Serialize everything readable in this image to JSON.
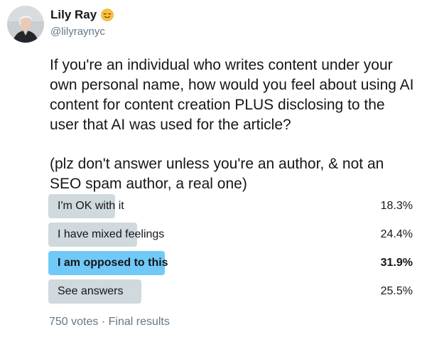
{
  "author": {
    "display_name": "Lily Ray",
    "handle": "@lilyraynyc",
    "emoji": "relieved-face-emoji"
  },
  "tweet": {
    "paragraph_1": "If you're an individual who writes content under your own personal name, how would you feel about using AI content for content creation PLUS disclosing to the user that AI was used for the article?",
    "paragraph_2": "(plz don't answer unless you're an author, & not an SEO spam author, a real one)"
  },
  "poll": {
    "options": [
      {
        "label": "I'm OK with it",
        "percent": "18.3%",
        "share": 0.183,
        "winner": false
      },
      {
        "label": "I have mixed feelings",
        "percent": "24.4%",
        "share": 0.244,
        "winner": false
      },
      {
        "label": "I am opposed to this",
        "percent": "31.9%",
        "share": 0.319,
        "winner": true
      },
      {
        "label": "See answers",
        "percent": "25.5%",
        "share": 0.255,
        "winner": false
      }
    ],
    "votes": "750 votes",
    "separator": "·",
    "status": "Final results"
  },
  "colors": {
    "bar": "#cfd9de",
    "winner_bar": "#71c9f8",
    "text": "#14171a",
    "secondary_text": "#657786"
  }
}
